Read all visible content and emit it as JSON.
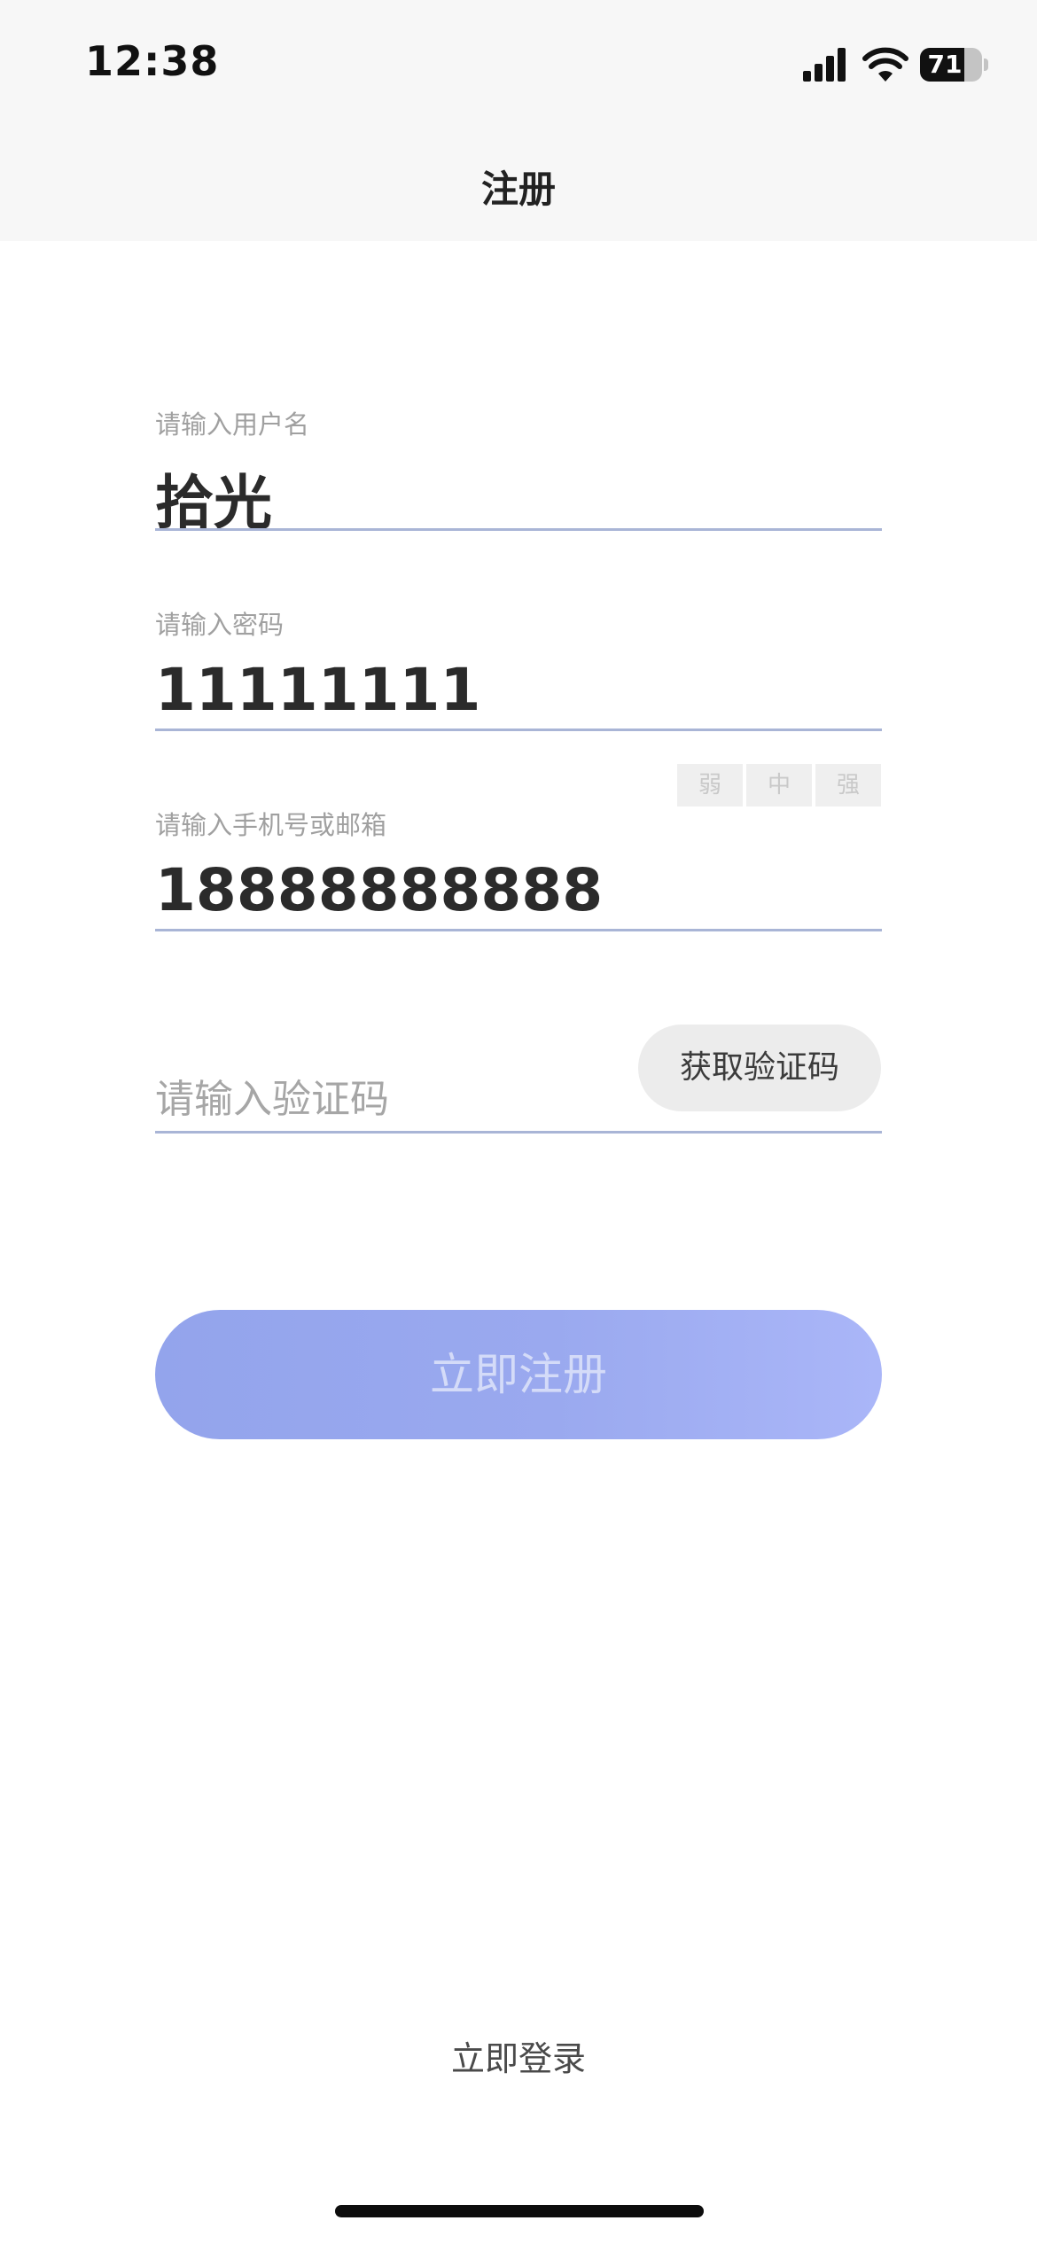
{
  "status_bar": {
    "time": "12:38",
    "battery_level": "71",
    "battery_fraction": 0.71,
    "icons": [
      "signal-icon",
      "wifi-icon",
      "battery-icon"
    ]
  },
  "nav": {
    "title": "注册"
  },
  "form": {
    "username": {
      "label": "请输入用户名",
      "value": "拾光"
    },
    "password": {
      "label": "请输入密码",
      "value": "11111111",
      "strength_levels": [
        "弱",
        "中",
        "强"
      ]
    },
    "contact": {
      "label": "请输入手机号或邮箱",
      "value": "18888888888"
    },
    "code": {
      "placeholder": "请输入验证码",
      "button_label": "获取验证码"
    }
  },
  "actions": {
    "register_label": "立即注册",
    "login_label": "立即登录"
  },
  "colors": {
    "accent": "#99a9ef",
    "underline": "#a9b5d6",
    "header_bg": "#f7f7f7"
  }
}
